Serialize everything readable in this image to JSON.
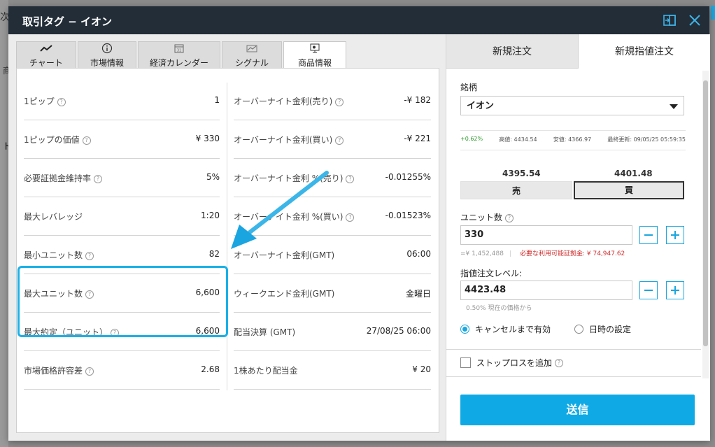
{
  "background": {
    "text1": "次",
    "text2": "商",
    "text3": "ト"
  },
  "window": {
    "title": "取引タグ − イオン"
  },
  "tabs": [
    {
      "label": "チャート",
      "icon": "chart-line-icon"
    },
    {
      "label": "市場情報",
      "icon": "info-icon"
    },
    {
      "label": "経済カレンダー",
      "icon": "calendar-icon"
    },
    {
      "label": "シグナル",
      "icon": "signal-icon"
    },
    {
      "label": "商品情報",
      "icon": "product-info-icon"
    }
  ],
  "info_left": [
    {
      "label": "1ピップ",
      "value": "1"
    },
    {
      "label": "1ピップの価値",
      "value": "¥ 330"
    },
    {
      "label": "必要証拠金維持率",
      "value": "5%"
    },
    {
      "label": "最大レバレッジ",
      "value": "1:20"
    },
    {
      "label": "最小ユニット数",
      "value": "82"
    },
    {
      "label": "最大ユニット数",
      "value": "6,600"
    },
    {
      "label": "最大約定（ユニット）",
      "value": "6,600"
    },
    {
      "label": "市場価格許容差",
      "value": "2.68"
    }
  ],
  "info_right": [
    {
      "label": "オーバーナイト金利(売り)",
      "value": "-¥ 182"
    },
    {
      "label": "オーバーナイト金利(買い)",
      "value": "-¥ 221"
    },
    {
      "label": "オーバーナイト金利 %(売り)",
      "value": "-0.01255%"
    },
    {
      "label": "オーバーナイト金利 %(買い)",
      "value": "-0.01523%"
    },
    {
      "label": "オーバーナイト金利(GMT)",
      "value": "06:00"
    },
    {
      "label": "ウィークエンド金利(GMT)",
      "value": "金曜日"
    },
    {
      "label": "配当決算 (GMT)",
      "value": "27/08/25 06:00"
    },
    {
      "label": "1株あたり配当金",
      "value": "¥ 20"
    }
  ],
  "order": {
    "tab_new_order": "新規注文",
    "tab_limit_order": "新規指値注文",
    "symbol_label": "銘柄",
    "symbol_value": "イオン",
    "stats": {
      "change": "+0.62%",
      "high_label": "高値:",
      "high": "4434.54",
      "low_label": "安値:",
      "low": "4366.97",
      "updated_label": "最終更新:",
      "updated": "09/05/25 05:59:35"
    },
    "sell_price": "4395.54",
    "buy_price": "4401.48",
    "sell_label": "売",
    "buy_label": "買",
    "units_label": "ユニット数",
    "units_value": "330",
    "units_hint": "=¥ 1,452,488",
    "margin_hint": "必要な利用可能証拠金: ¥ 74,947.62",
    "level_label": "指値注文レベル:",
    "level_value": "4423.48",
    "level_hint": "0.50% 現在の価格から",
    "radio_gtc": "キャンセルまで有効",
    "radio_date": "日時の設定",
    "stoploss_label": "ストップロスを追加",
    "submit_label": "送信"
  },
  "colors": {
    "accent": "#0faae6",
    "title_bar": "#222d38",
    "positive": "#2a9a2a",
    "warning": "#d03030"
  }
}
